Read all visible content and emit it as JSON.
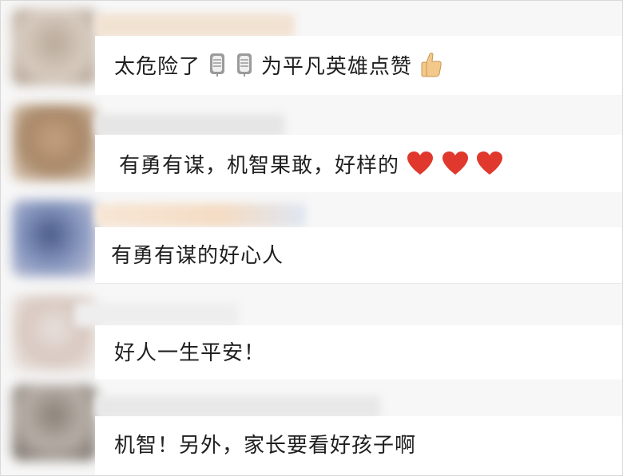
{
  "comments": [
    {
      "text_before": "太危险了",
      "emojis_middle": [
        "microphone-icon",
        "microphone-icon"
      ],
      "text_after": "为平凡英雄点赞",
      "emoji_end": "thumbs-up-icon",
      "avatar_colors": [
        "#b8a898",
        "#d8ccc0",
        "#a89888"
      ],
      "name_color": "#f2e2d2"
    },
    {
      "text": "有勇有谋，机智果敢，好样的",
      "emojis_end": [
        "heart-icon",
        "heart-icon",
        "heart-icon"
      ],
      "avatar_colors": [
        "#c4a080",
        "#a88868",
        "#e0d0c0"
      ],
      "name_color": "#e6e6e6"
    },
    {
      "text": "有勇有谋的好心人",
      "avatar_colors": [
        "#4a5a88",
        "#8898c0",
        "#c8c8d8"
      ],
      "name_color": "#f4dcc4"
    },
    {
      "text": "好人一生平安！",
      "avatar_colors": [
        "#e8e0dc",
        "#d8c8c0",
        "#f0ece8"
      ],
      "name_color": "#eeeeee"
    },
    {
      "text": "机智！另外，家长要看好孩子啊",
      "avatar_colors": [
        "#8a8078",
        "#b8b0a8",
        "#706860"
      ],
      "name_color": "#e8e8e8"
    }
  ],
  "colors": {
    "heart": "#e0382d",
    "thumb": "#f2c98a"
  }
}
